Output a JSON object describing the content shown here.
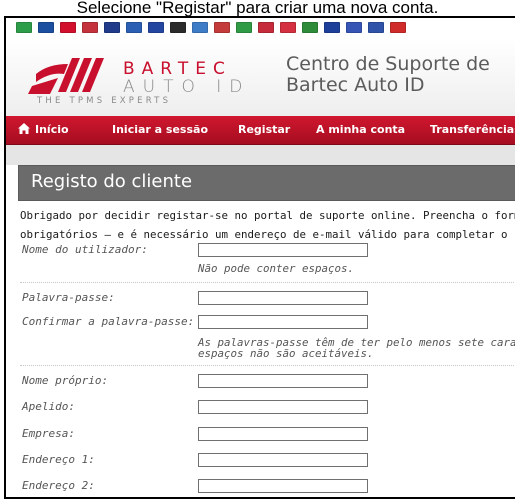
{
  "caption": "Selecione \"Registar\" para criar uma nova conta.",
  "flags": [
    {
      "name": "bulgaria-flag-icon",
      "color": "#2e9d4a"
    },
    {
      "name": "czech-flag-icon",
      "color": "#1c4fa0"
    },
    {
      "name": "denmark-flag-icon",
      "color": "#d2102e"
    },
    {
      "name": "netherlands-flag-icon",
      "color": "#c4323b"
    },
    {
      "name": "uk-flag-icon",
      "color": "#1f3b8a"
    },
    {
      "name": "finland-flag-icon",
      "color": "#2a5fb3"
    },
    {
      "name": "france-flag-icon",
      "color": "#2446a1"
    },
    {
      "name": "germany-flag-icon",
      "color": "#2b2b2b"
    },
    {
      "name": "greece-flag-icon",
      "color": "#3f7cc7"
    },
    {
      "name": "hungary-flag-icon",
      "color": "#c33b3b"
    },
    {
      "name": "italy-flag-icon",
      "color": "#2f9b46"
    },
    {
      "name": "norway-flag-icon",
      "color": "#c52b3a"
    },
    {
      "name": "poland-flag-icon",
      "color": "#d4303f"
    },
    {
      "name": "portugal-flag-icon",
      "color": "#2e8b3a"
    },
    {
      "name": "romania-flag-icon",
      "color": "#1d3f9a"
    },
    {
      "name": "russia-flag-icon",
      "color": "#3655b5"
    },
    {
      "name": "slovakia-flag-icon",
      "color": "#2e53a8"
    },
    {
      "name": "spain-flag-icon",
      "color": "#cf2b2b"
    }
  ],
  "brand": {
    "line1": "BARTEC",
    "line2": "AUTO ID",
    "tagline": "THE TPMS EXPERTS",
    "accent": "#c8102e"
  },
  "site_title": {
    "line1": "Centro de Suporte de",
    "line2": "Bartec Auto ID"
  },
  "nav": {
    "home": "Início",
    "login": "Iniciar a sessão",
    "register": "Registar",
    "account": "A minha conta",
    "downloads": "Transferências"
  },
  "page": {
    "title": "Registo do cliente",
    "intro_line1": "Obrigado por decidir registar-se no portal de suporte online. Preencha o formulário abaixo",
    "intro_line2": "obrigatórios – e é necessário um endereço de e-mail válido para completar o processo."
  },
  "form": {
    "username_label": "Nome do utilizador:",
    "username_hint": "Não pode conter espaços.",
    "password_label": "Palavra-passe:",
    "confirm_label": "Confirmar a palavra-passe:",
    "password_hint_line1": "As palavras-passe têm de ter pelo menos sete caracteres;",
    "password_hint_line2": "espaços não são aceitáveis.",
    "firstname_label": "Nome próprio:",
    "lastname_label": "Apelido:",
    "company_label": "Empresa:",
    "address1_label": "Endereço 1:",
    "address2_label": "Endereço 2:"
  }
}
